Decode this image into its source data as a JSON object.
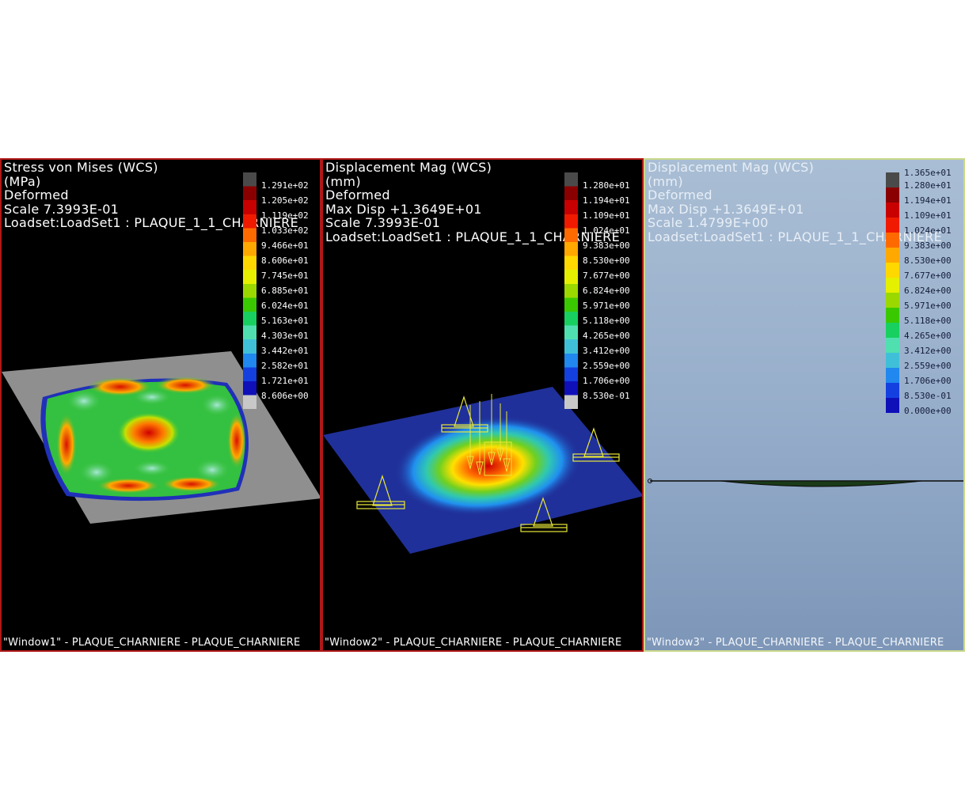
{
  "windows": [
    {
      "header": [
        "Stress von Mises (WCS)",
        "(MPa)",
        "Deformed",
        "Scale  7.3993E-01",
        "Loadset:LoadSet1 :  PLAQUE_1_1_CHARNIERE"
      ],
      "footer": "\"Window1\" - PLAQUE_CHARNIERE - PLAQUE_CHARNIERE",
      "legend_ticks": [
        "1.291e+02",
        "1.205e+02",
        "1.119e+02",
        "1.033e+02",
        "9.466e+01",
        "8.606e+01",
        "7.745e+01",
        "6.885e+01",
        "6.024e+01",
        "5.163e+01",
        "4.303e+01",
        "3.442e+01",
        "2.582e+01",
        "1.721e+01",
        "8.606e+00"
      ],
      "legend_top": ""
    },
    {
      "header": [
        "Displacement Mag (WCS)",
        "(mm)",
        "Deformed",
        "Max Disp   +1.3649E+01",
        "Scale  7.3993E-01",
        "Loadset:LoadSet1 :  PLAQUE_1_1_CHARNIERE"
      ],
      "footer": "\"Window2\" - PLAQUE_CHARNIERE - PLAQUE_CHARNIERE",
      "legend_ticks": [
        "1.280e+01",
        "1.194e+01",
        "1.109e+01",
        "1.024e+01",
        "9.383e+00",
        "8.530e+00",
        "7.677e+00",
        "6.824e+00",
        "5.971e+00",
        "5.118e+00",
        "4.265e+00",
        "3.412e+00",
        "2.559e+00",
        "1.706e+00",
        "8.530e-01"
      ],
      "legend_top": ""
    },
    {
      "header": [
        "Displacement Mag (WCS)",
        "(mm)",
        "Deformed",
        "Max Disp   +1.3649E+01",
        "Scale  1.4799E+00",
        "Loadset:LoadSet1 :  PLAQUE_1_1_CHARNIERE"
      ],
      "footer": "\"Window3\" - PLAQUE_CHARNIERE - PLAQUE_CHARNIERE",
      "legend_ticks": [
        "1.280e+01",
        "1.194e+01",
        "1.109e+01",
        "1.024e+01",
        "9.383e+00",
        "8.530e+00",
        "7.677e+00",
        "6.824e+00",
        "5.971e+00",
        "5.118e+00",
        "4.265e+00",
        "3.412e+00",
        "2.559e+00",
        "1.706e+00",
        "8.530e-01",
        "0.000e+00"
      ],
      "legend_top": "1.365e+01"
    }
  ],
  "colors": {
    "panel_border_active": "#b01818",
    "panel_border_3": "#c9d98a",
    "constraint_yellow": "#e8e838"
  },
  "legend_palette": [
    "#4a4a4a",
    "#8a0000",
    "#c80000",
    "#f01a00",
    "#ff6a00",
    "#ffa800",
    "#ffd800",
    "#e4f000",
    "#9ad800",
    "#3ac800",
    "#18d060",
    "#50e0b0",
    "#40c0d8",
    "#2088ee",
    "#1440e0",
    "#1010b8",
    "#c8c8c8"
  ]
}
